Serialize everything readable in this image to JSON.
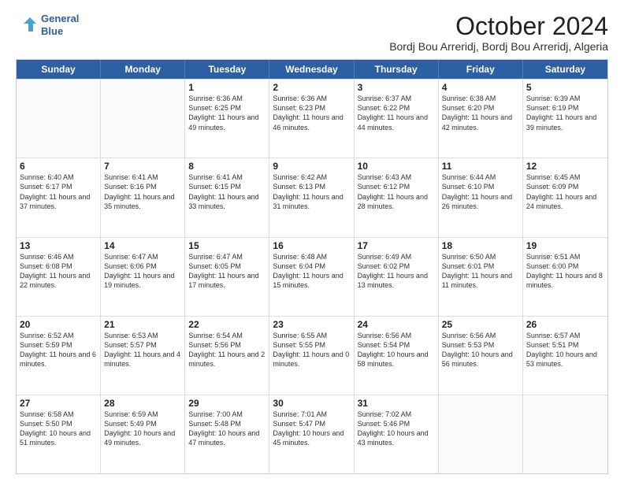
{
  "header": {
    "logo_line1": "General",
    "logo_line2": "Blue",
    "title": "October 2024",
    "subtitle": "Bordj Bou Arreridj, Bordj Bou Arreridj, Algeria"
  },
  "days": [
    "Sunday",
    "Monday",
    "Tuesday",
    "Wednesday",
    "Thursday",
    "Friday",
    "Saturday"
  ],
  "rows": [
    [
      {
        "day": "",
        "sunrise": "",
        "sunset": "",
        "daylight": ""
      },
      {
        "day": "",
        "sunrise": "",
        "sunset": "",
        "daylight": ""
      },
      {
        "day": "1",
        "sunrise": "Sunrise: 6:36 AM",
        "sunset": "Sunset: 6:25 PM",
        "daylight": "Daylight: 11 hours and 49 minutes."
      },
      {
        "day": "2",
        "sunrise": "Sunrise: 6:36 AM",
        "sunset": "Sunset: 6:23 PM",
        "daylight": "Daylight: 11 hours and 46 minutes."
      },
      {
        "day": "3",
        "sunrise": "Sunrise: 6:37 AM",
        "sunset": "Sunset: 6:22 PM",
        "daylight": "Daylight: 11 hours and 44 minutes."
      },
      {
        "day": "4",
        "sunrise": "Sunrise: 6:38 AM",
        "sunset": "Sunset: 6:20 PM",
        "daylight": "Daylight: 11 hours and 42 minutes."
      },
      {
        "day": "5",
        "sunrise": "Sunrise: 6:39 AM",
        "sunset": "Sunset: 6:19 PM",
        "daylight": "Daylight: 11 hours and 39 minutes."
      }
    ],
    [
      {
        "day": "6",
        "sunrise": "Sunrise: 6:40 AM",
        "sunset": "Sunset: 6:17 PM",
        "daylight": "Daylight: 11 hours and 37 minutes."
      },
      {
        "day": "7",
        "sunrise": "Sunrise: 6:41 AM",
        "sunset": "Sunset: 6:16 PM",
        "daylight": "Daylight: 11 hours and 35 minutes."
      },
      {
        "day": "8",
        "sunrise": "Sunrise: 6:41 AM",
        "sunset": "Sunset: 6:15 PM",
        "daylight": "Daylight: 11 hours and 33 minutes."
      },
      {
        "day": "9",
        "sunrise": "Sunrise: 6:42 AM",
        "sunset": "Sunset: 6:13 PM",
        "daylight": "Daylight: 11 hours and 31 minutes."
      },
      {
        "day": "10",
        "sunrise": "Sunrise: 6:43 AM",
        "sunset": "Sunset: 6:12 PM",
        "daylight": "Daylight: 11 hours and 28 minutes."
      },
      {
        "day": "11",
        "sunrise": "Sunrise: 6:44 AM",
        "sunset": "Sunset: 6:10 PM",
        "daylight": "Daylight: 11 hours and 26 minutes."
      },
      {
        "day": "12",
        "sunrise": "Sunrise: 6:45 AM",
        "sunset": "Sunset: 6:09 PM",
        "daylight": "Daylight: 11 hours and 24 minutes."
      }
    ],
    [
      {
        "day": "13",
        "sunrise": "Sunrise: 6:46 AM",
        "sunset": "Sunset: 6:08 PM",
        "daylight": "Daylight: 11 hours and 22 minutes."
      },
      {
        "day": "14",
        "sunrise": "Sunrise: 6:47 AM",
        "sunset": "Sunset: 6:06 PM",
        "daylight": "Daylight: 11 hours and 19 minutes."
      },
      {
        "day": "15",
        "sunrise": "Sunrise: 6:47 AM",
        "sunset": "Sunset: 6:05 PM",
        "daylight": "Daylight: 11 hours and 17 minutes."
      },
      {
        "day": "16",
        "sunrise": "Sunrise: 6:48 AM",
        "sunset": "Sunset: 6:04 PM",
        "daylight": "Daylight: 11 hours and 15 minutes."
      },
      {
        "day": "17",
        "sunrise": "Sunrise: 6:49 AM",
        "sunset": "Sunset: 6:02 PM",
        "daylight": "Daylight: 11 hours and 13 minutes."
      },
      {
        "day": "18",
        "sunrise": "Sunrise: 6:50 AM",
        "sunset": "Sunset: 6:01 PM",
        "daylight": "Daylight: 11 hours and 11 minutes."
      },
      {
        "day": "19",
        "sunrise": "Sunrise: 6:51 AM",
        "sunset": "Sunset: 6:00 PM",
        "daylight": "Daylight: 11 hours and 8 minutes."
      }
    ],
    [
      {
        "day": "20",
        "sunrise": "Sunrise: 6:52 AM",
        "sunset": "Sunset: 5:59 PM",
        "daylight": "Daylight: 11 hours and 6 minutes."
      },
      {
        "day": "21",
        "sunrise": "Sunrise: 6:53 AM",
        "sunset": "Sunset: 5:57 PM",
        "daylight": "Daylight: 11 hours and 4 minutes."
      },
      {
        "day": "22",
        "sunrise": "Sunrise: 6:54 AM",
        "sunset": "Sunset: 5:56 PM",
        "daylight": "Daylight: 11 hours and 2 minutes."
      },
      {
        "day": "23",
        "sunrise": "Sunrise: 6:55 AM",
        "sunset": "Sunset: 5:55 PM",
        "daylight": "Daylight: 11 hours and 0 minutes."
      },
      {
        "day": "24",
        "sunrise": "Sunrise: 6:56 AM",
        "sunset": "Sunset: 5:54 PM",
        "daylight": "Daylight: 10 hours and 58 minutes."
      },
      {
        "day": "25",
        "sunrise": "Sunrise: 6:56 AM",
        "sunset": "Sunset: 5:53 PM",
        "daylight": "Daylight: 10 hours and 56 minutes."
      },
      {
        "day": "26",
        "sunrise": "Sunrise: 6:57 AM",
        "sunset": "Sunset: 5:51 PM",
        "daylight": "Daylight: 10 hours and 53 minutes."
      }
    ],
    [
      {
        "day": "27",
        "sunrise": "Sunrise: 6:58 AM",
        "sunset": "Sunset: 5:50 PM",
        "daylight": "Daylight: 10 hours and 51 minutes."
      },
      {
        "day": "28",
        "sunrise": "Sunrise: 6:59 AM",
        "sunset": "Sunset: 5:49 PM",
        "daylight": "Daylight: 10 hours and 49 minutes."
      },
      {
        "day": "29",
        "sunrise": "Sunrise: 7:00 AM",
        "sunset": "Sunset: 5:48 PM",
        "daylight": "Daylight: 10 hours and 47 minutes."
      },
      {
        "day": "30",
        "sunrise": "Sunrise: 7:01 AM",
        "sunset": "Sunset: 5:47 PM",
        "daylight": "Daylight: 10 hours and 45 minutes."
      },
      {
        "day": "31",
        "sunrise": "Sunrise: 7:02 AM",
        "sunset": "Sunset: 5:46 PM",
        "daylight": "Daylight: 10 hours and 43 minutes."
      },
      {
        "day": "",
        "sunrise": "",
        "sunset": "",
        "daylight": ""
      },
      {
        "day": "",
        "sunrise": "",
        "sunset": "",
        "daylight": ""
      }
    ]
  ]
}
